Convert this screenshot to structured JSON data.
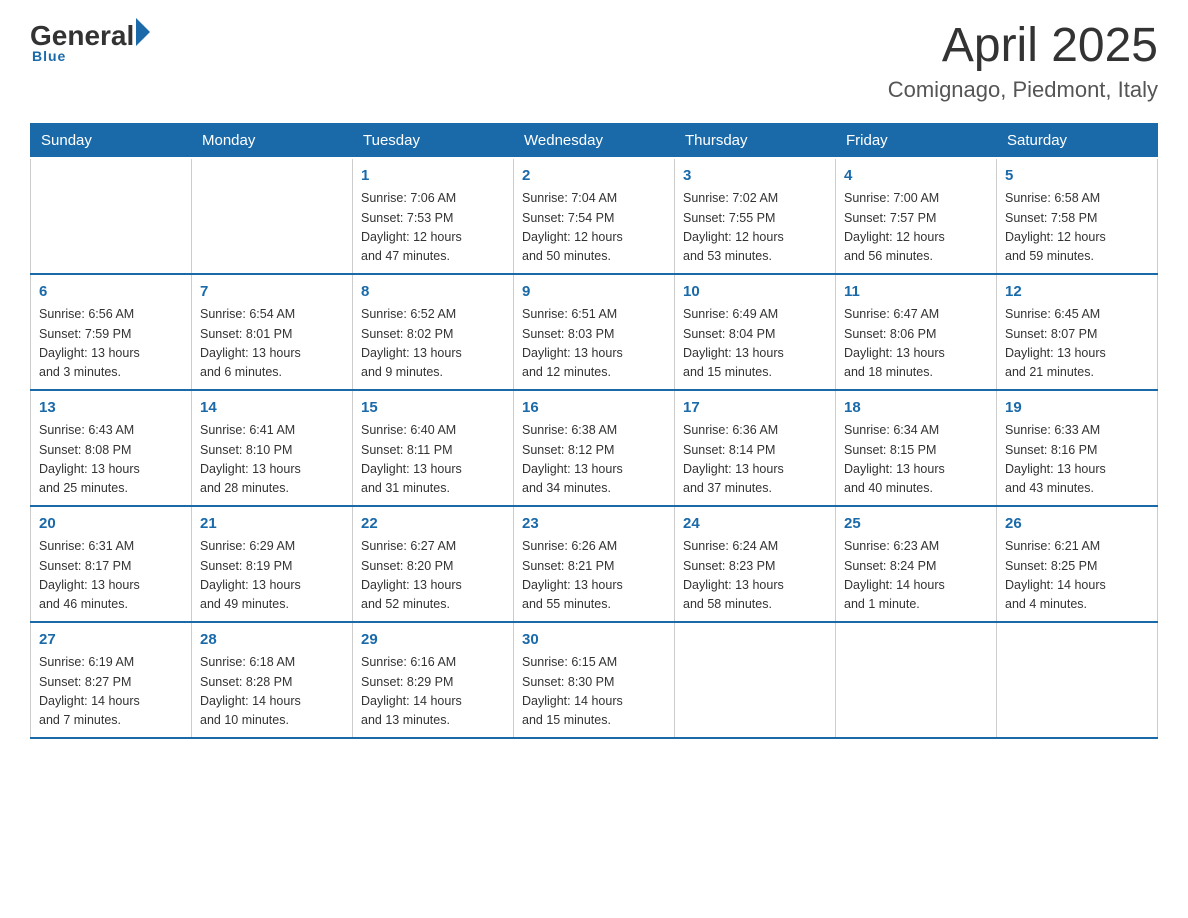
{
  "header": {
    "logo": {
      "general": "General",
      "arrow": "▶",
      "blue": "Blue"
    },
    "title": "April 2025",
    "location": "Comignago, Piedmont, Italy"
  },
  "days_of_week": [
    "Sunday",
    "Monday",
    "Tuesday",
    "Wednesday",
    "Thursday",
    "Friday",
    "Saturday"
  ],
  "weeks": [
    [
      {
        "day": "",
        "info": ""
      },
      {
        "day": "",
        "info": ""
      },
      {
        "day": "1",
        "info": "Sunrise: 7:06 AM\nSunset: 7:53 PM\nDaylight: 12 hours\nand 47 minutes."
      },
      {
        "day": "2",
        "info": "Sunrise: 7:04 AM\nSunset: 7:54 PM\nDaylight: 12 hours\nand 50 minutes."
      },
      {
        "day": "3",
        "info": "Sunrise: 7:02 AM\nSunset: 7:55 PM\nDaylight: 12 hours\nand 53 minutes."
      },
      {
        "day": "4",
        "info": "Sunrise: 7:00 AM\nSunset: 7:57 PM\nDaylight: 12 hours\nand 56 minutes."
      },
      {
        "day": "5",
        "info": "Sunrise: 6:58 AM\nSunset: 7:58 PM\nDaylight: 12 hours\nand 59 minutes."
      }
    ],
    [
      {
        "day": "6",
        "info": "Sunrise: 6:56 AM\nSunset: 7:59 PM\nDaylight: 13 hours\nand 3 minutes."
      },
      {
        "day": "7",
        "info": "Sunrise: 6:54 AM\nSunset: 8:01 PM\nDaylight: 13 hours\nand 6 minutes."
      },
      {
        "day": "8",
        "info": "Sunrise: 6:52 AM\nSunset: 8:02 PM\nDaylight: 13 hours\nand 9 minutes."
      },
      {
        "day": "9",
        "info": "Sunrise: 6:51 AM\nSunset: 8:03 PM\nDaylight: 13 hours\nand 12 minutes."
      },
      {
        "day": "10",
        "info": "Sunrise: 6:49 AM\nSunset: 8:04 PM\nDaylight: 13 hours\nand 15 minutes."
      },
      {
        "day": "11",
        "info": "Sunrise: 6:47 AM\nSunset: 8:06 PM\nDaylight: 13 hours\nand 18 minutes."
      },
      {
        "day": "12",
        "info": "Sunrise: 6:45 AM\nSunset: 8:07 PM\nDaylight: 13 hours\nand 21 minutes."
      }
    ],
    [
      {
        "day": "13",
        "info": "Sunrise: 6:43 AM\nSunset: 8:08 PM\nDaylight: 13 hours\nand 25 minutes."
      },
      {
        "day": "14",
        "info": "Sunrise: 6:41 AM\nSunset: 8:10 PM\nDaylight: 13 hours\nand 28 minutes."
      },
      {
        "day": "15",
        "info": "Sunrise: 6:40 AM\nSunset: 8:11 PM\nDaylight: 13 hours\nand 31 minutes."
      },
      {
        "day": "16",
        "info": "Sunrise: 6:38 AM\nSunset: 8:12 PM\nDaylight: 13 hours\nand 34 minutes."
      },
      {
        "day": "17",
        "info": "Sunrise: 6:36 AM\nSunset: 8:14 PM\nDaylight: 13 hours\nand 37 minutes."
      },
      {
        "day": "18",
        "info": "Sunrise: 6:34 AM\nSunset: 8:15 PM\nDaylight: 13 hours\nand 40 minutes."
      },
      {
        "day": "19",
        "info": "Sunrise: 6:33 AM\nSunset: 8:16 PM\nDaylight: 13 hours\nand 43 minutes."
      }
    ],
    [
      {
        "day": "20",
        "info": "Sunrise: 6:31 AM\nSunset: 8:17 PM\nDaylight: 13 hours\nand 46 minutes."
      },
      {
        "day": "21",
        "info": "Sunrise: 6:29 AM\nSunset: 8:19 PM\nDaylight: 13 hours\nand 49 minutes."
      },
      {
        "day": "22",
        "info": "Sunrise: 6:27 AM\nSunset: 8:20 PM\nDaylight: 13 hours\nand 52 minutes."
      },
      {
        "day": "23",
        "info": "Sunrise: 6:26 AM\nSunset: 8:21 PM\nDaylight: 13 hours\nand 55 minutes."
      },
      {
        "day": "24",
        "info": "Sunrise: 6:24 AM\nSunset: 8:23 PM\nDaylight: 13 hours\nand 58 minutes."
      },
      {
        "day": "25",
        "info": "Sunrise: 6:23 AM\nSunset: 8:24 PM\nDaylight: 14 hours\nand 1 minute."
      },
      {
        "day": "26",
        "info": "Sunrise: 6:21 AM\nSunset: 8:25 PM\nDaylight: 14 hours\nand 4 minutes."
      }
    ],
    [
      {
        "day": "27",
        "info": "Sunrise: 6:19 AM\nSunset: 8:27 PM\nDaylight: 14 hours\nand 7 minutes."
      },
      {
        "day": "28",
        "info": "Sunrise: 6:18 AM\nSunset: 8:28 PM\nDaylight: 14 hours\nand 10 minutes."
      },
      {
        "day": "29",
        "info": "Sunrise: 6:16 AM\nSunset: 8:29 PM\nDaylight: 14 hours\nand 13 minutes."
      },
      {
        "day": "30",
        "info": "Sunrise: 6:15 AM\nSunset: 8:30 PM\nDaylight: 14 hours\nand 15 minutes."
      },
      {
        "day": "",
        "info": ""
      },
      {
        "day": "",
        "info": ""
      },
      {
        "day": "",
        "info": ""
      }
    ]
  ]
}
